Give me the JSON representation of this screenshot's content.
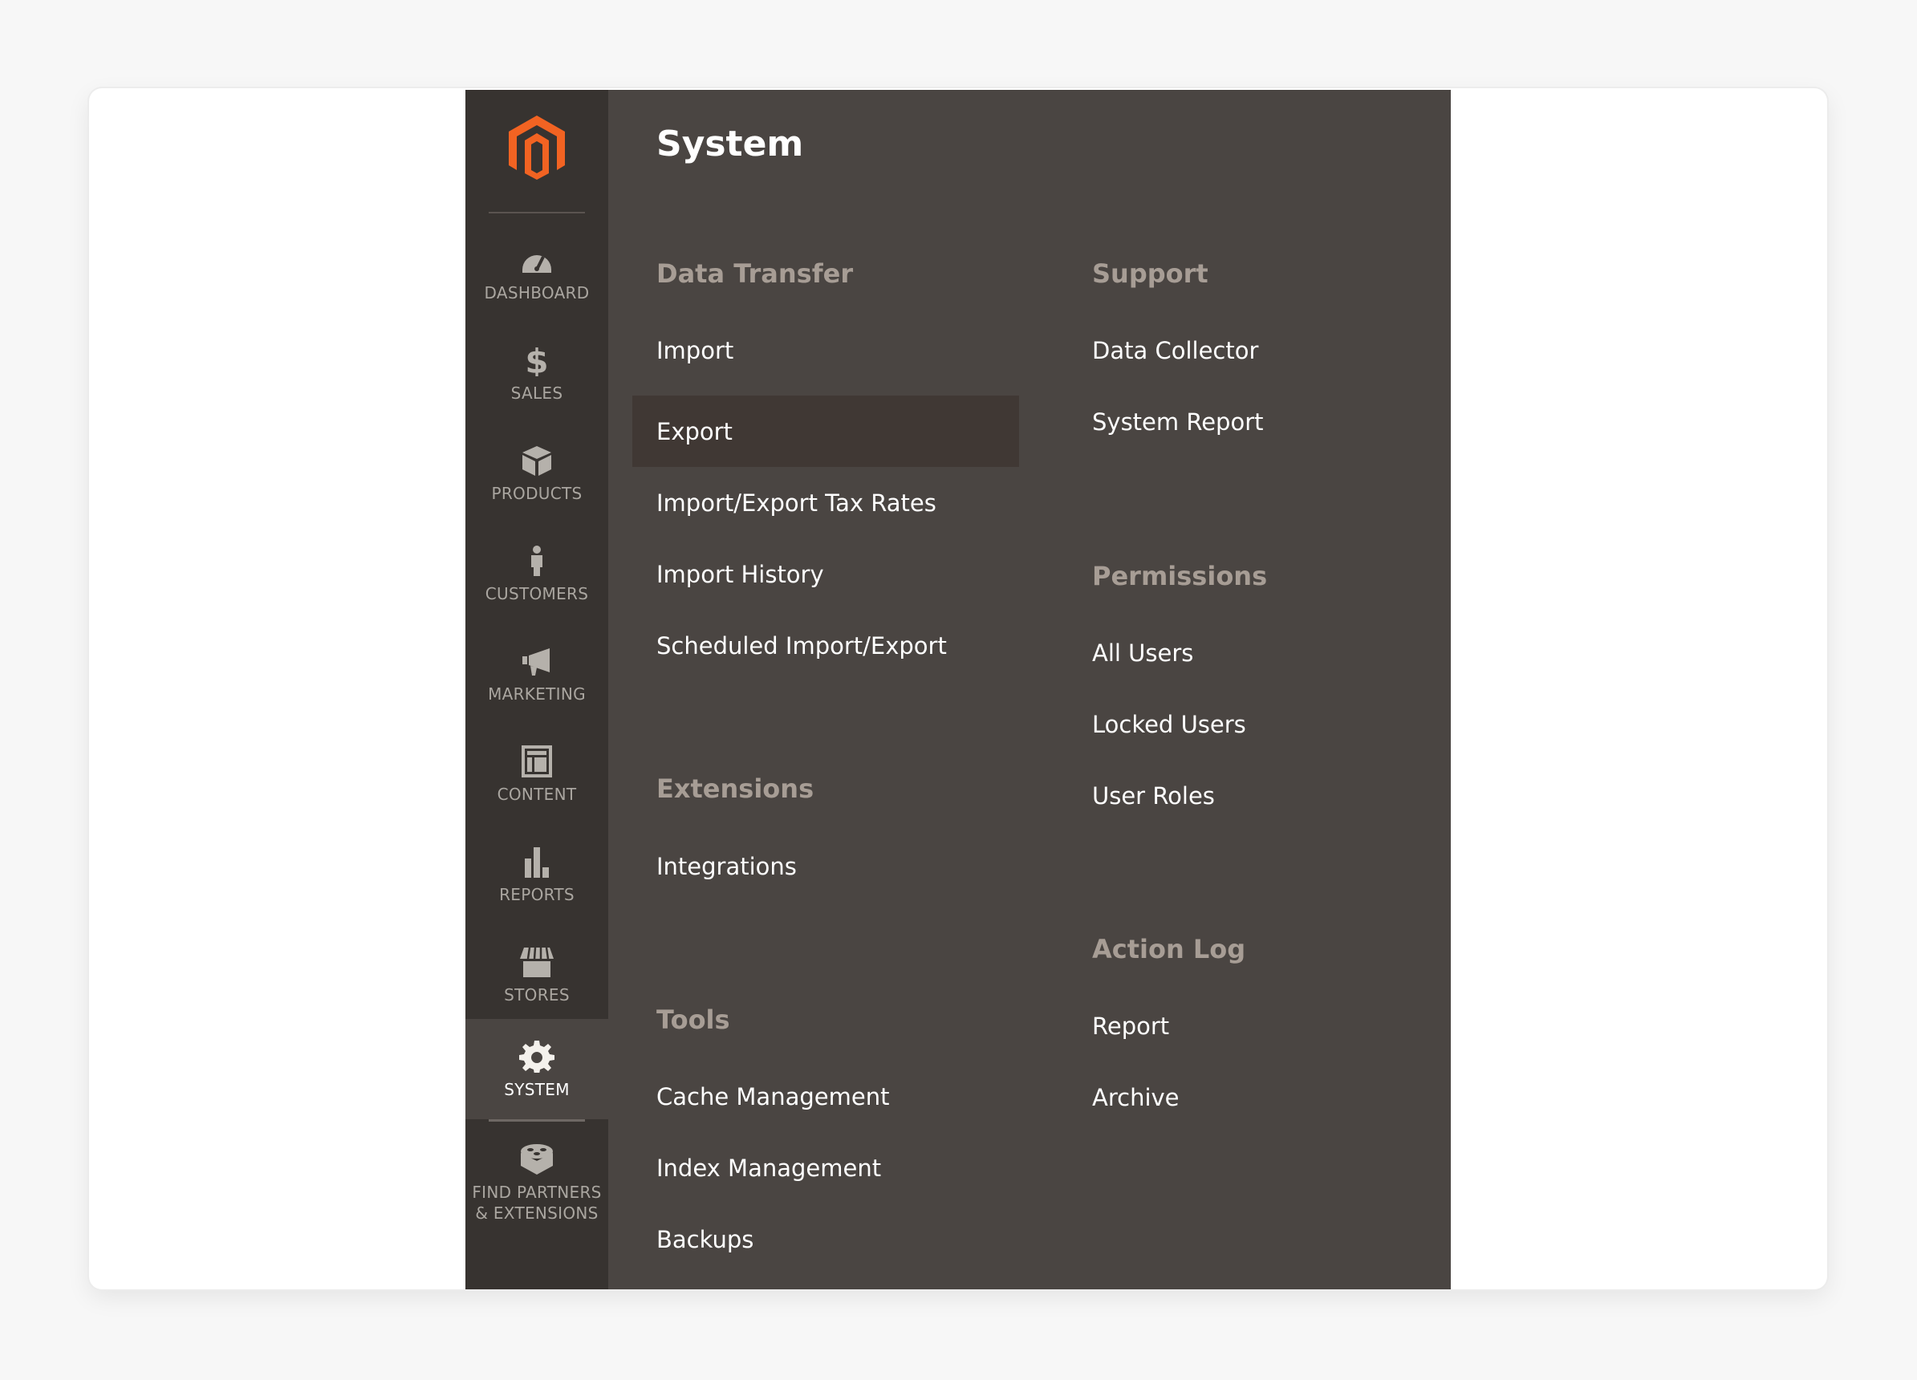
{
  "brand": {
    "logo": "magento-logo-icon",
    "accent": "#f26322"
  },
  "sidebar": {
    "items": [
      {
        "label": "DASHBOARD",
        "icon": "dashboard-gauge-icon"
      },
      {
        "label": "SALES",
        "icon": "dollar-icon"
      },
      {
        "label": "PRODUCTS",
        "icon": "box-icon"
      },
      {
        "label": "CUSTOMERS",
        "icon": "person-icon"
      },
      {
        "label": "MARKETING",
        "icon": "megaphone-icon"
      },
      {
        "label": "CONTENT",
        "icon": "layout-icon"
      },
      {
        "label": "REPORTS",
        "icon": "bar-chart-icon"
      },
      {
        "label": "STORES",
        "icon": "storefront-icon"
      },
      {
        "label": "SYSTEM",
        "icon": "gear-icon",
        "active": true
      },
      {
        "label": "FIND PARTNERS",
        "label2": "& EXTENSIONS",
        "icon": "lego-brick-icon"
      }
    ]
  },
  "panel": {
    "title": "System",
    "sections": {
      "data_transfer": {
        "title": "Data Transfer",
        "items": [
          "Import",
          "Export",
          "Import/Export Tax Rates",
          "Import History",
          "Scheduled Import/Export"
        ],
        "active": "Export"
      },
      "extensions": {
        "title": "Extensions",
        "items": [
          "Integrations"
        ]
      },
      "tools": {
        "title": "Tools",
        "items": [
          "Cache Management",
          "Index Management",
          "Backups"
        ]
      },
      "support": {
        "title": "Support",
        "items": [
          "Data Collector",
          "System Report"
        ]
      },
      "permissions": {
        "title": "Permissions",
        "items": [
          "All Users",
          "Locked Users",
          "User Roles"
        ]
      },
      "action_log": {
        "title": "Action Log",
        "items": [
          "Report",
          "Archive"
        ]
      }
    }
  }
}
